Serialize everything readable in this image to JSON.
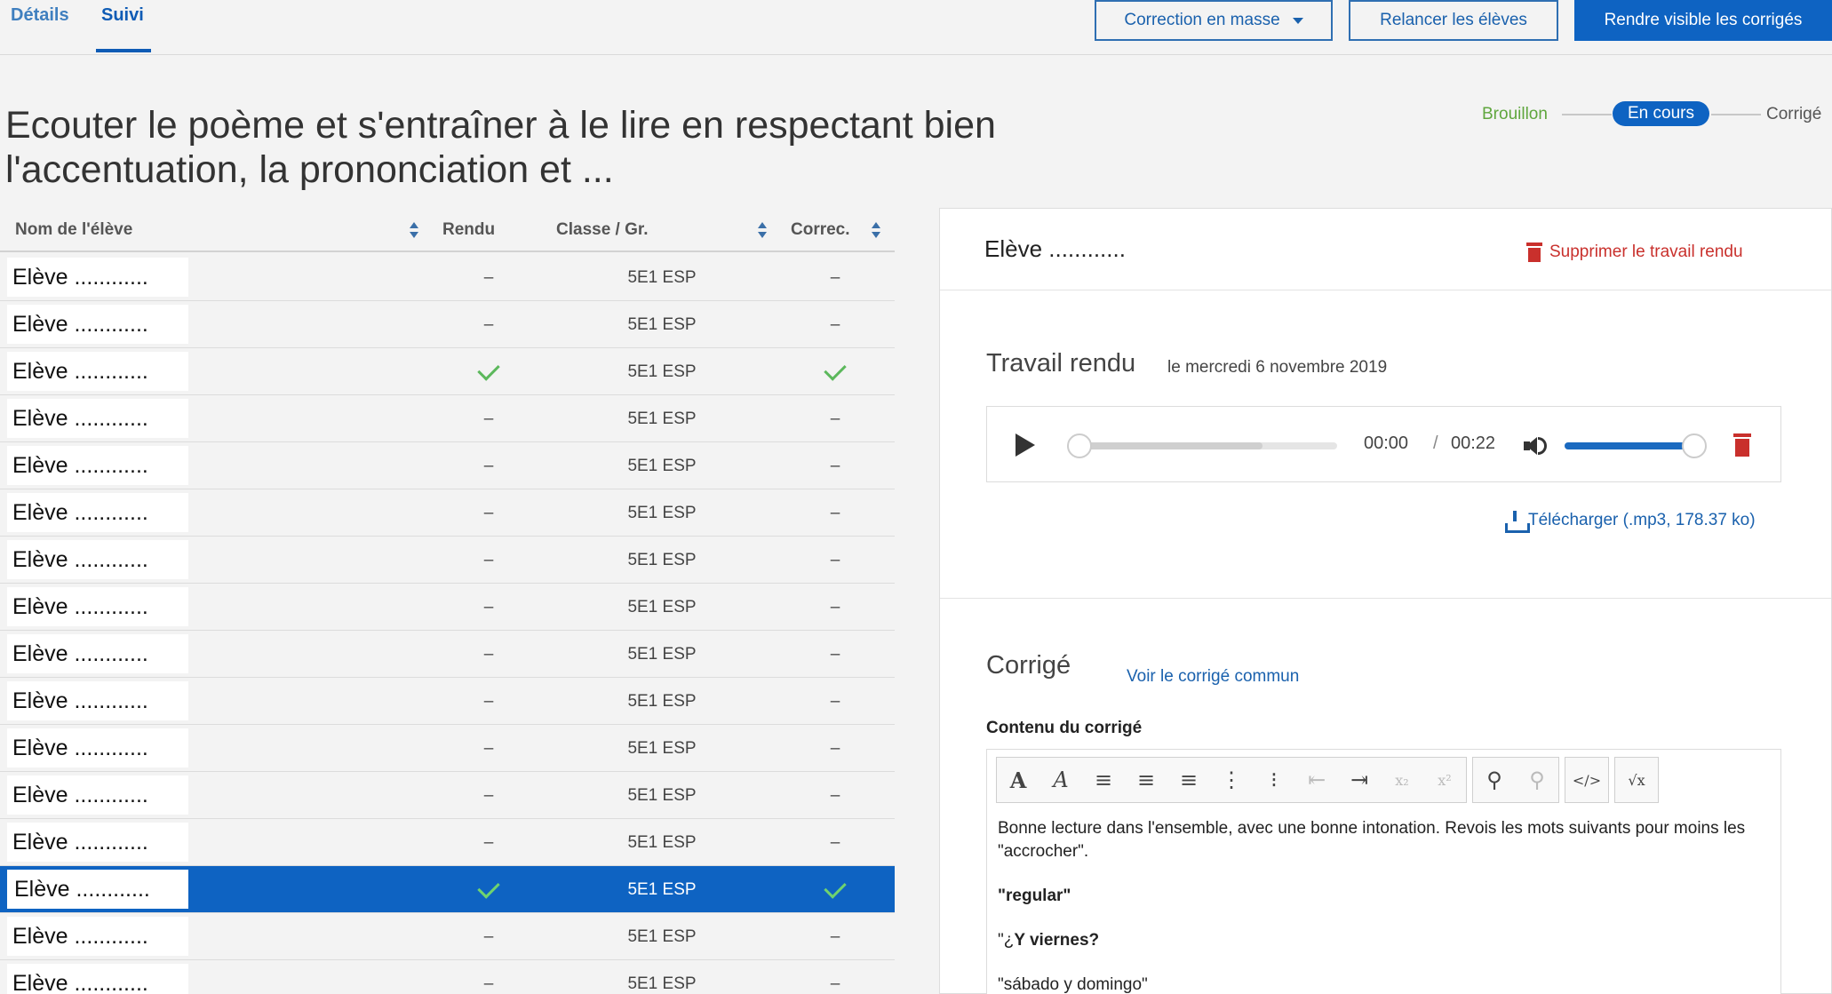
{
  "tabs": [
    {
      "label": "Détails"
    },
    {
      "label": "Suivi"
    }
  ],
  "actions": {
    "correction": "Correction en masse",
    "relancer": "Relancer les élèves",
    "visible": "Rendre visible les corrigés"
  },
  "title": "Ecouter le poème et s'entraîner à le lire en respectant bien l'accentuation, la prononciation et ...",
  "status": {
    "brouillon": "Brouillon",
    "en_cours": "En cours",
    "corrige": "Corrigé"
  },
  "table": {
    "headers": {
      "nom": "Nom de l'élève",
      "rendu": "Rendu",
      "classe": "Classe / Gr.",
      "correc": "Correc."
    },
    "rows": [
      {
        "name": "Elève ............",
        "rendu": "–",
        "classe": "5E1 ESP",
        "correc": "–"
      },
      {
        "name": "Elève ............",
        "rendu": "–",
        "classe": "5E1 ESP",
        "correc": "–"
      },
      {
        "name": "Elève ............",
        "rendu": "check",
        "classe": "5E1 ESP",
        "correc": "check"
      },
      {
        "name": "Elève ............",
        "rendu": "–",
        "classe": "5E1 ESP",
        "correc": "–"
      },
      {
        "name": "Elève ............",
        "rendu": "–",
        "classe": "5E1 ESP",
        "correc": "–"
      },
      {
        "name": "Elève ............",
        "rendu": "–",
        "classe": "5E1 ESP",
        "correc": "–"
      },
      {
        "name": "Elève ............",
        "rendu": "–",
        "classe": "5E1 ESP",
        "correc": "–"
      },
      {
        "name": "Elève ............",
        "rendu": "–",
        "classe": "5E1 ESP",
        "correc": "–"
      },
      {
        "name": "Elève ............",
        "rendu": "–",
        "classe": "5E1 ESP",
        "correc": "–"
      },
      {
        "name": "Elève ............",
        "rendu": "–",
        "classe": "5E1 ESP",
        "correc": "–"
      },
      {
        "name": "Elève ............",
        "rendu": "–",
        "classe": "5E1 ESP",
        "correc": "–"
      },
      {
        "name": "Elève ............",
        "rendu": "–",
        "classe": "5E1 ESP",
        "correc": "–"
      },
      {
        "name": "Elève ............",
        "rendu": "–",
        "classe": "5E1 ESP",
        "correc": "–"
      },
      {
        "name": "Elève ............",
        "rendu": "check",
        "classe": "5E1 ESP",
        "correc": "check",
        "selected": true
      },
      {
        "name": "Elève ............",
        "rendu": "–",
        "classe": "5E1 ESP",
        "correc": "–"
      },
      {
        "name": "Elève ............",
        "rendu": "–",
        "classe": "5E1 ESP",
        "correc": "–"
      }
    ]
  },
  "panel": {
    "student": "Elève ............",
    "delete": "Supprimer le travail rendu",
    "rendu_title": "Travail rendu",
    "rendu_date": "le mercredi 6 novembre 2019",
    "audio": {
      "current": "00:00",
      "separator": "/",
      "total": "00:22",
      "buffered": 0.72,
      "volume": 0.92
    },
    "download": "Télécharger (.mp3, 178.37 ko)",
    "corrige_title": "Corrigé",
    "voir": "Voir le corrigé commun",
    "contenu_label": "Contenu du corrigé",
    "toolbar": [
      {
        "icon": "font-color-icon",
        "glyph": "A",
        "disabled": false
      },
      {
        "icon": "italic-icon",
        "glyph": "A",
        "disabled": false
      },
      {
        "icon": "align-left-icon",
        "glyph": "≡",
        "disabled": false
      },
      {
        "icon": "align-center-icon",
        "glyph": "≡",
        "disabled": false
      },
      {
        "icon": "align-right-icon",
        "glyph": "≡",
        "disabled": false
      },
      {
        "icon": "ordered-list-icon",
        "glyph": "⋮",
        "disabled": false
      },
      {
        "icon": "unordered-list-icon",
        "glyph": "⁝",
        "disabled": false
      },
      {
        "icon": "outdent-icon",
        "glyph": "⇤",
        "disabled": true
      },
      {
        "icon": "indent-icon",
        "glyph": "⇥",
        "disabled": false
      },
      {
        "icon": "subscript-icon",
        "glyph": "x₂",
        "disabled": true
      },
      {
        "icon": "superscript-icon",
        "glyph": "x²",
        "disabled": true
      },
      {
        "icon": "link-icon",
        "glyph": "⚲",
        "disabled": false
      },
      {
        "icon": "unlink-icon",
        "glyph": "⚲",
        "disabled": true
      },
      {
        "icon": "code-icon",
        "glyph": "</>",
        "disabled": false
      },
      {
        "icon": "formula-icon",
        "glyph": "√x",
        "disabled": false
      }
    ],
    "content": {
      "intro": "Bonne lecture dans l'ensemble, avec une bonne intonation. Revois les mots suivants pour moins les \"accrocher\".",
      "word1": "\"regular\"",
      "line2_pre": "\"¿",
      "line2_bold": "Y viernes?",
      "line3": "\"sábado y domingo\""
    }
  },
  "colors": {
    "primary": "#0e63c2",
    "link": "#1a61ad",
    "success": "#5cb85c",
    "danger": "#c9302c",
    "draft": "#5fa63d"
  }
}
